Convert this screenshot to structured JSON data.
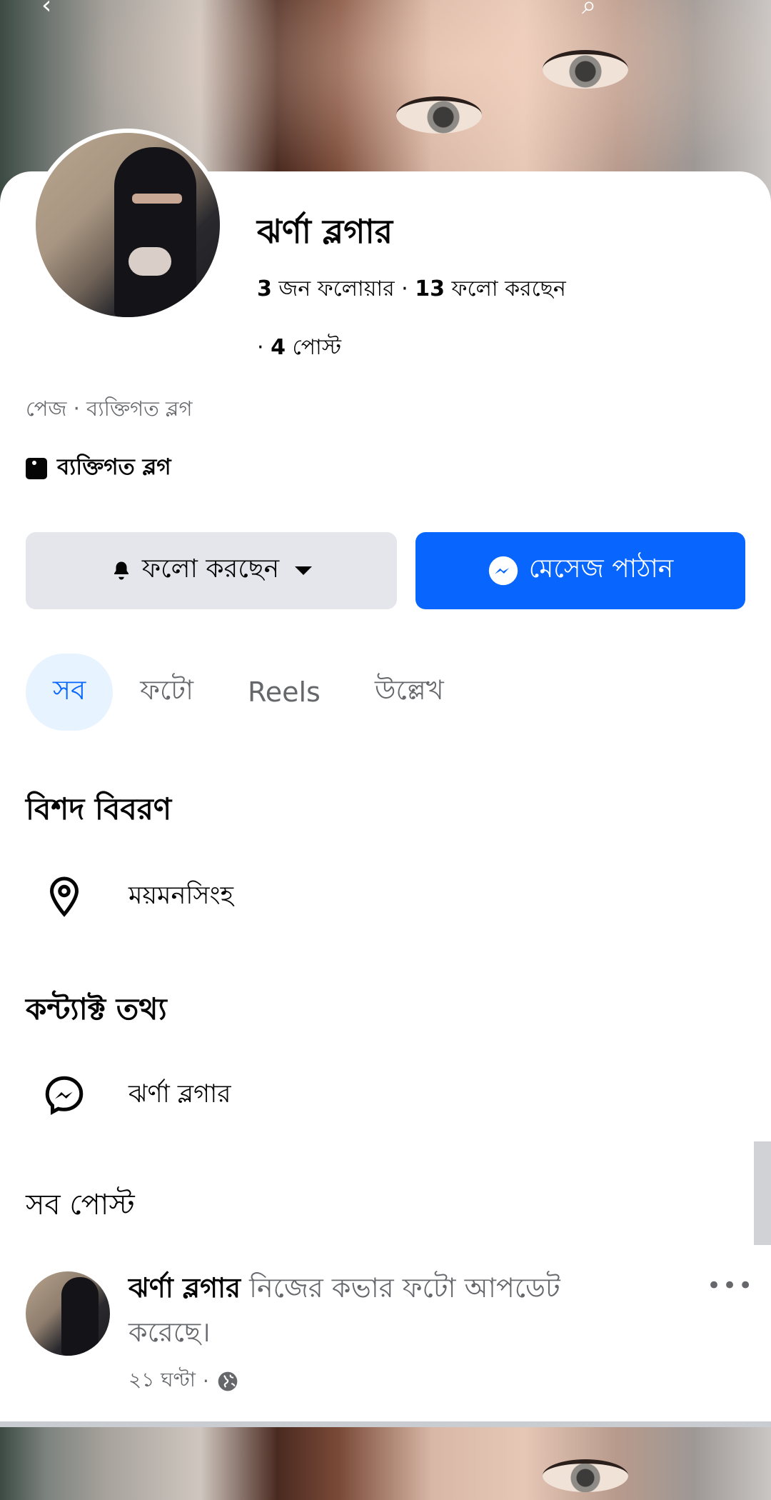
{
  "profile": {
    "name": "ঝর্ণা ব্লগার",
    "followers_count": "3",
    "followers_label": "জন ফলোয়ার",
    "following_count": "13",
    "following_label": "ফলো করছেন",
    "posts_count": "4",
    "posts_label": "পোস্ট",
    "category_line": "পেজ · ব্যক্তিগত ব্লগ",
    "category_tag": "ব্যক্তিগত ব্লগ"
  },
  "actions": {
    "follow_label": "ফলো করছেন",
    "message_label": "মেসেজ পাঠান"
  },
  "tabs": [
    "সব",
    "ফটো",
    "Reels",
    "উল্লেখ"
  ],
  "details": {
    "title": "বিশদ বিবরণ",
    "location": "ময়মনসিংহ"
  },
  "contact": {
    "title": "কন্ট্যাক্ট তথ্য",
    "messenger": "ঝর্ণা ব্লগার"
  },
  "posts": {
    "title": "সব পোস্ট",
    "items": [
      {
        "author": "ঝর্ণা ব্লগার",
        "action": "নিজের কভার ফটো আপডেট করেছে।",
        "time": "২১ ঘণ্টা"
      }
    ]
  },
  "colors": {
    "accent": "#0866ff",
    "button_gray": "#e4e6eb",
    "tab_active_bg": "#e7f3ff",
    "secondary_text": "#65676b"
  },
  "icons": [
    "back-arrow-icon",
    "search-icon",
    "bell-icon",
    "caret-down-icon",
    "messenger-icon",
    "location-pin-icon",
    "globe-icon",
    "more-icon",
    "page-category-icon"
  ]
}
